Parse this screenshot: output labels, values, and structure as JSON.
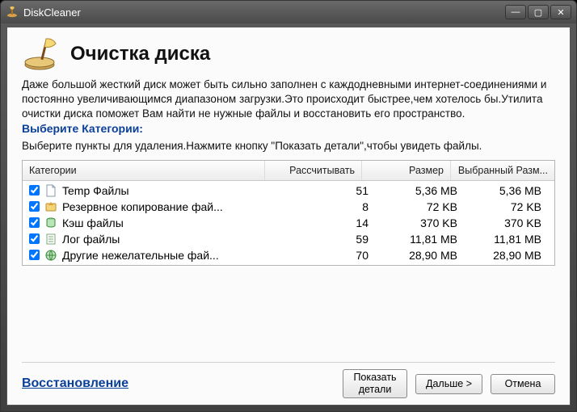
{
  "window": {
    "title": "DiskCleaner"
  },
  "page": {
    "title": "Очистка диска",
    "description": "Даже большой жесткий диск может быть сильно заполнен с каждодневными интернет-соединениями и постоянно увеличивающимся диапазоном загрузки.Это происходит быстрее,чем хотелось бы.Утилита очистки диска поможет Вам найти не нужные файлы и восстановить его пространство.",
    "subhead": "Выберите Категории:",
    "instruction": "Выберите пункты для удаления.Нажмите кнопку \"Показать детали\",чтобы увидеть файлы."
  },
  "table": {
    "headers": {
      "category": "Категории",
      "count": "Рассчитывать",
      "size": "Размер",
      "selected": "Выбранный Разм..."
    },
    "rows": [
      {
        "checked": true,
        "icon": "file",
        "label": "Temp Файлы",
        "count": "51",
        "size": "5,36 MB",
        "selected": "5,36 MB"
      },
      {
        "checked": true,
        "icon": "backup",
        "label": "Резервное копирование фай...",
        "count": "8",
        "size": "72 KB",
        "selected": "72 KB"
      },
      {
        "checked": true,
        "icon": "cache",
        "label": "Кэш файлы",
        "count": "14",
        "size": "370 KB",
        "selected": "370 KB"
      },
      {
        "checked": true,
        "icon": "log",
        "label": "Лог файлы",
        "count": "59",
        "size": "11,81 MB",
        "selected": "11,81 MB"
      },
      {
        "checked": true,
        "icon": "other",
        "label": "Другие нежелательные фай...",
        "count": "70",
        "size": "28,90 MB",
        "selected": "28,90 MB"
      }
    ]
  },
  "footer": {
    "link": "Восстановление",
    "details": "Показать\nдетали",
    "next": "Дальше >",
    "cancel": "Отмена"
  }
}
